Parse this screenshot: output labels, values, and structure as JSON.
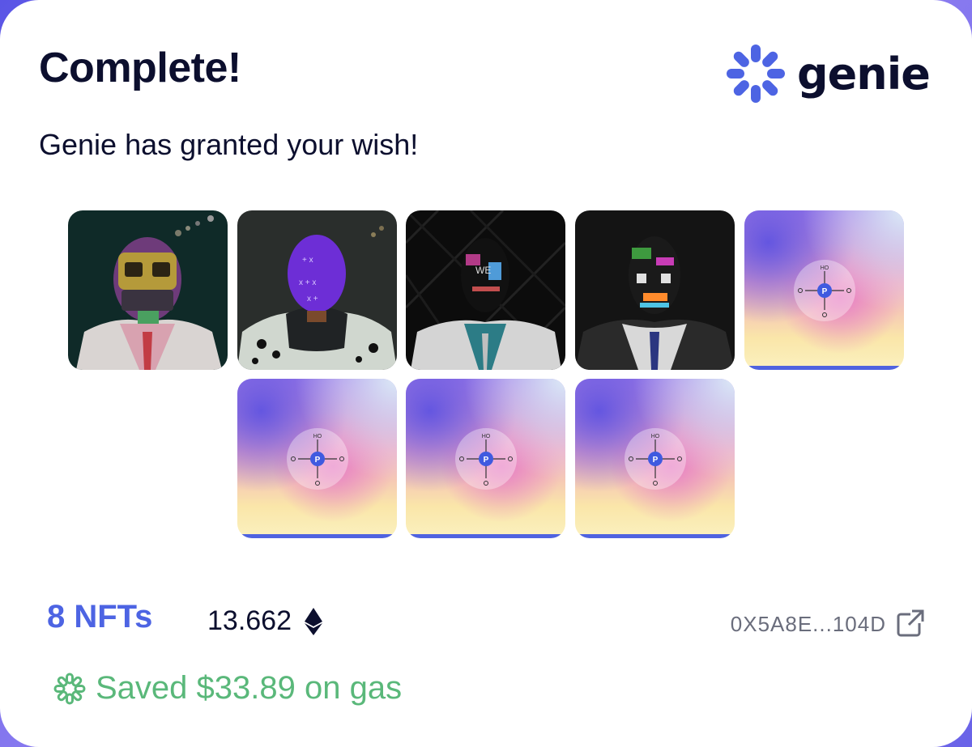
{
  "header": {
    "title": "Complete!",
    "subtitle": "Genie has granted your wish!",
    "brand_name": "genie",
    "brand_color": "#4d64e3"
  },
  "nfts": [
    {
      "id": "nft-1",
      "status": "revealed",
      "icon": "nft-portrait-gold-mask"
    },
    {
      "id": "nft-2",
      "status": "revealed",
      "icon": "nft-portrait-purple-head"
    },
    {
      "id": "nft-3",
      "status": "revealed",
      "icon": "nft-portrait-graffiti-dark"
    },
    {
      "id": "nft-4",
      "status": "revealed",
      "icon": "nft-portrait-graffiti-skull"
    },
    {
      "id": "nft-5",
      "status": "pending",
      "icon": "nft-placeholder-compass",
      "compass_label": "HO",
      "center_letter": "P"
    },
    {
      "id": "nft-6",
      "status": "pending",
      "icon": "nft-placeholder-compass",
      "compass_label": "HO",
      "center_letter": "P"
    },
    {
      "id": "nft-7",
      "status": "pending",
      "icon": "nft-placeholder-compass",
      "compass_label": "HO",
      "center_letter": "P"
    },
    {
      "id": "nft-8",
      "status": "pending",
      "icon": "nft-placeholder-compass",
      "compass_label": "HO",
      "center_letter": "P"
    }
  ],
  "summary": {
    "count_label": "8 NFTs",
    "price": "13.662",
    "currency_icon": "ethereum-icon",
    "address": "0X5A8E...104D",
    "external_link_icon": "external-link-icon",
    "savings_text": "Saved $33.89 on gas",
    "savings_color": "#5ab87a"
  }
}
